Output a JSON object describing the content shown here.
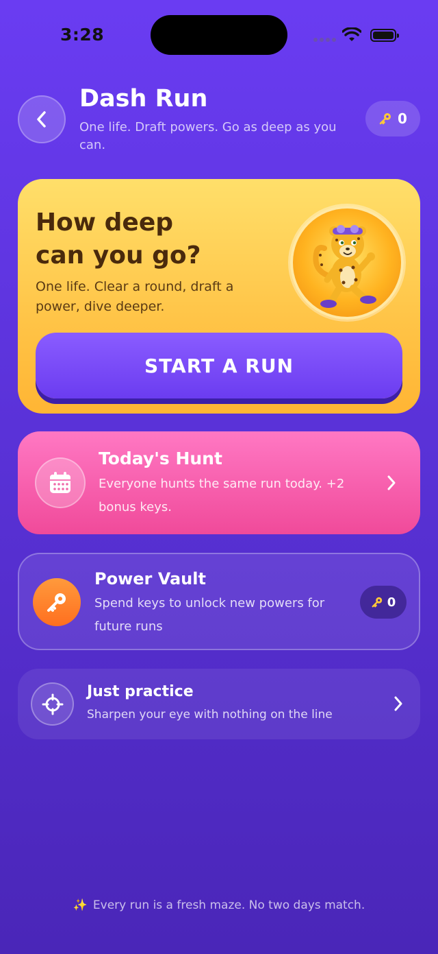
{
  "status_bar": {
    "time": "3:28"
  },
  "header": {
    "title": "Dash Run",
    "subtitle": "One life. Draft powers. Go as deep as you can.",
    "keys": "0"
  },
  "hero": {
    "title_line1": "How deep",
    "title_line2": "can you go?",
    "body": "One life. Clear a round, draft a power, dive deeper.",
    "start_label": "START A RUN"
  },
  "hunt": {
    "title": "Today's Hunt",
    "body": "Everyone hunts the same run today. +2 bonus keys."
  },
  "vault": {
    "title": "Power Vault",
    "body": "Spend keys to unlock new powers for future runs",
    "keys": "0"
  },
  "practice": {
    "title": "Just practice",
    "body": "Sharpen your eye with nothing on the line"
  },
  "footer": {
    "text": "Every run is a fresh maze. No two days match."
  },
  "colors": {
    "background": "#6a3cf2",
    "hero_gold": "#ffc447",
    "start_purple": "#6b3cf0",
    "hunt_pink": "#f04a9a",
    "vault_orange": "#ff6f1f",
    "key_gold": "#ffc83a"
  },
  "icons": [
    "chevron-left-icon",
    "key-icon",
    "cheetah-mascot",
    "calendar-icon",
    "chevron-right-icon",
    "crosshair-icon",
    "sparkle-icon"
  ]
}
